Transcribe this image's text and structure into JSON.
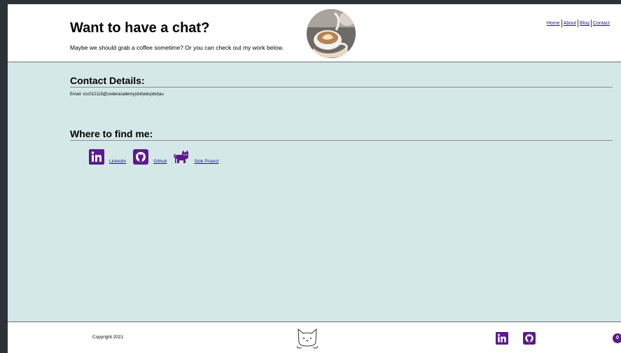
{
  "header": {
    "title": "Want to have a chat?",
    "subtitle": "Maybe we should grab a coffee sometime? Or you can check out my work below.",
    "nav": [
      "Home",
      "About",
      "Blog",
      "Contact"
    ]
  },
  "contact": {
    "heading": "Contact Details:",
    "email": "Email: ccc012115@coderacademy(dot)edu(dot)au"
  },
  "find": {
    "heading": "Where to find me:",
    "links": [
      {
        "label": "Linkedin",
        "icon": "linkedin-icon"
      },
      {
        "label": " Github",
        "icon": "github-icon"
      },
      {
        "label": "Side Project",
        "icon": "cat-icon"
      }
    ]
  },
  "footer": {
    "copyright": "Copyright 2021",
    "badge": "0"
  },
  "colors": {
    "accent": "#5c1a8c",
    "main_bg": "#d5e8e8",
    "frame": "#2d3138"
  }
}
